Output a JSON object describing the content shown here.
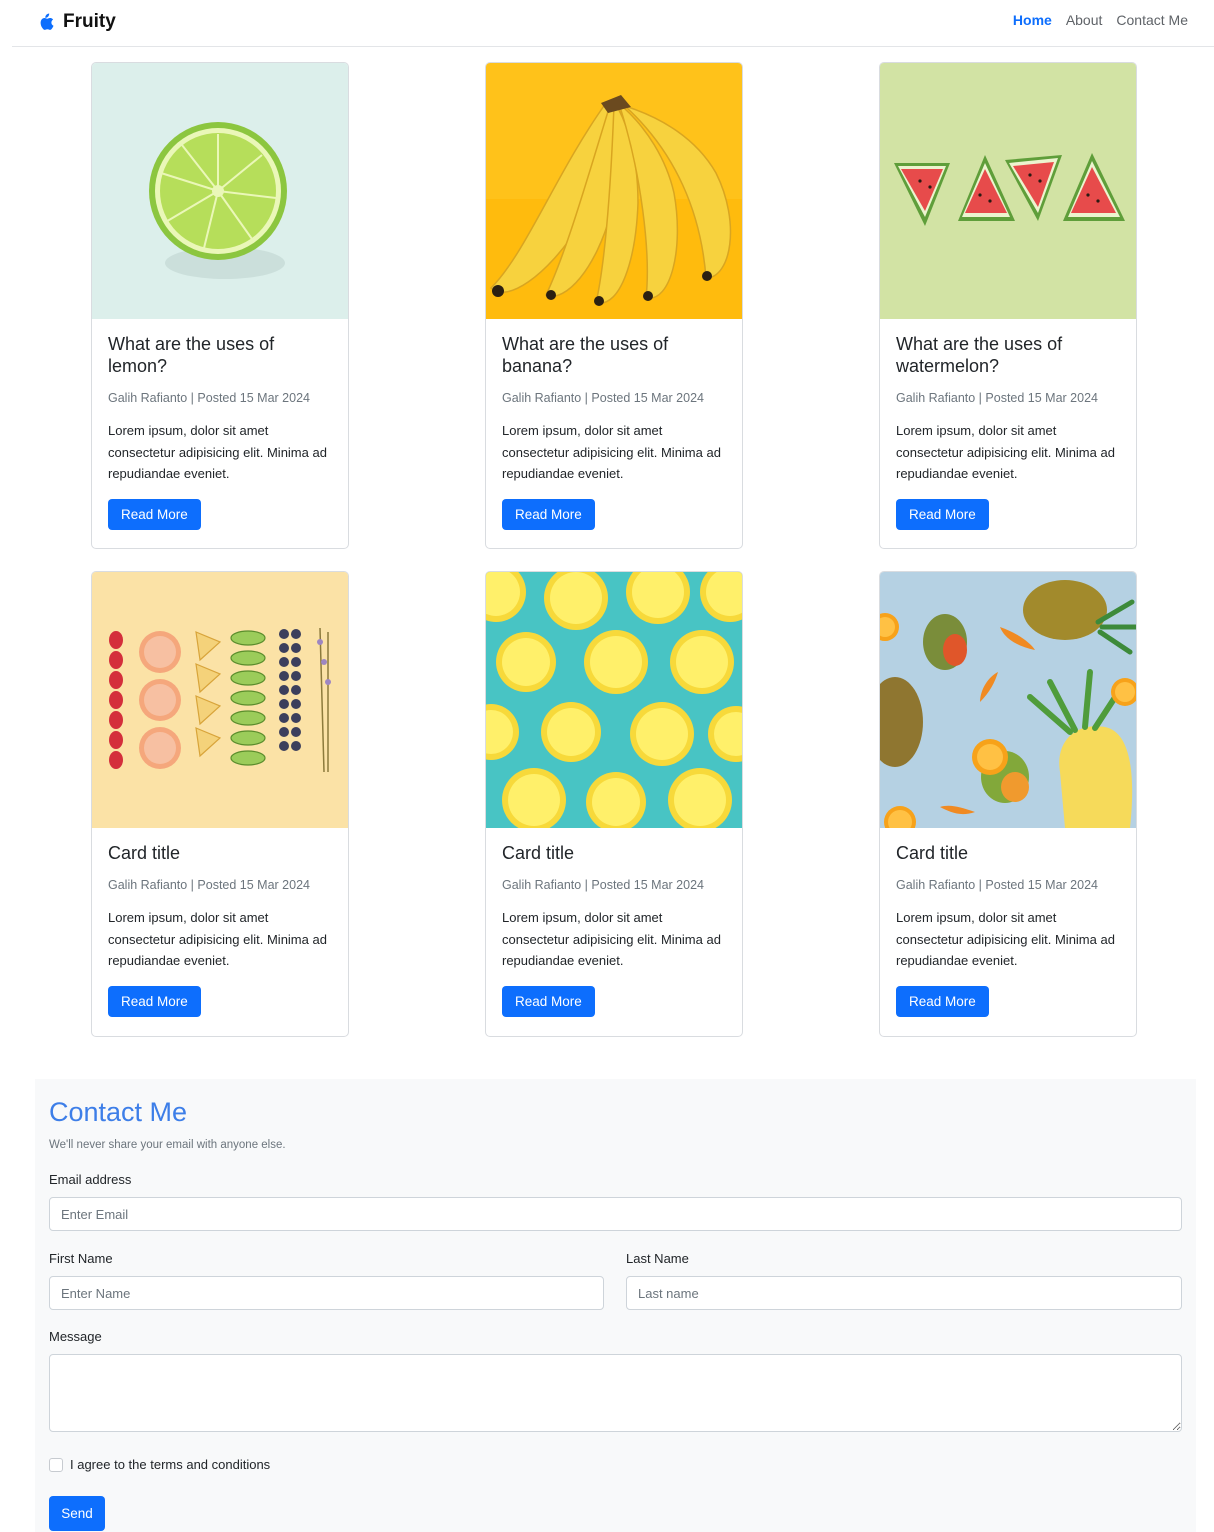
{
  "navbar": {
    "brand": "Fruity",
    "brand_icon": "apple-icon",
    "links": [
      "Home",
      "About",
      "Contact Me"
    ],
    "active_link": "Home"
  },
  "cards": [
    {
      "title": "What are the uses of lemon?",
      "meta": "Galih Rafianto | Posted 15 Mar 2024",
      "text": "Lorem ipsum, dolor sit amet consectetur adipisicing elit. Minima ad repudiandae eveniet.",
      "button": "Read More",
      "image": "lime-slice"
    },
    {
      "title": "What are the uses of banana?",
      "meta": "Galih Rafianto | Posted 15 Mar 2024",
      "text": "Lorem ipsum, dolor sit amet consectetur adipisicing elit. Minima ad repudiandae eveniet.",
      "button": "Read More",
      "image": "banana-bunch"
    },
    {
      "title": "What are the uses of watermelon?",
      "meta": "Galih Rafianto | Posted 15 Mar 2024",
      "text": "Lorem ipsum, dolor sit amet consectetur adipisicing elit. Minima ad repudiandae eveniet.",
      "button": "Read More",
      "image": "watermelon-slices"
    },
    {
      "title": "Card title",
      "meta": "Galih Rafianto | Posted 15 Mar 2024",
      "text": "Lorem ipsum, dolor sit amet consectetur adipisicing elit. Minima ad repudiandae eveniet.",
      "button": "Read More",
      "image": "fruit-rows"
    },
    {
      "title": "Card title",
      "meta": "Galih Rafianto | Posted 15 Mar 2024",
      "text": "Lorem ipsum, dolor sit amet consectetur adipisicing elit. Minima ad repudiandae eveniet.",
      "button": "Read More",
      "image": "lemon-pattern"
    },
    {
      "title": "Card title",
      "meta": "Galih Rafianto | Posted 15 Mar 2024",
      "text": "Lorem ipsum, dolor sit amet consectetur adipisicing elit. Minima ad repudiandae eveniet.",
      "button": "Read More",
      "image": "pineapple-mango"
    }
  ],
  "contact": {
    "title": "Contact Me",
    "note": "We'll never share your email with anyone else.",
    "email_label": "Email address",
    "email_placeholder": "Enter Email",
    "email_value": "",
    "first_name_label": "First Name",
    "first_name_placeholder": "Enter Name",
    "first_name_value": "",
    "last_name_label": "Last Name",
    "last_name_placeholder": "Last name",
    "last_name_value": "",
    "message_label": "Message",
    "message_value": "",
    "terms_label": "I agree to the terms and conditions",
    "terms_checked": false,
    "send_button": "Send"
  },
  "colors": {
    "primary": "#0d6efd",
    "contact_title": "#3d7ee8",
    "contact_bg": "#f8f9fa"
  }
}
